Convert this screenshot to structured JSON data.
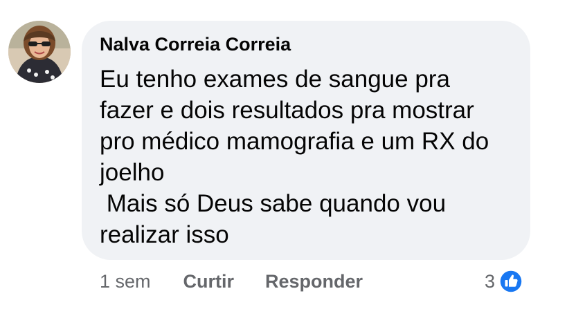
{
  "comment": {
    "author": "Nalva Correia Correia",
    "text_lines": [
      "Eu tenho exames de sangue pra",
      "fazer e dois resultados pra mostrar",
      "pro médico mamografia e um RX do",
      "joelho",
      " Mais só Deus sabe quando vou",
      "realizar isso"
    ]
  },
  "actions": {
    "time": "1 sem",
    "like_label": "Curtir",
    "reply_label": "Responder"
  },
  "reactions": {
    "count": "3",
    "icon": "like-thumbs-up-icon",
    "color": "#1877f2"
  },
  "colors": {
    "bubble_background": "#f0f2f5",
    "secondary_text": "#65676b",
    "primary_text": "#050505"
  }
}
